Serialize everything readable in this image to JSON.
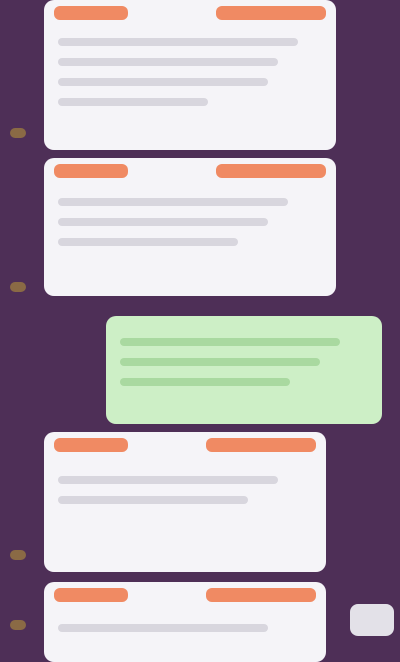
{
  "colors": {
    "background": "#4e2f57",
    "incoming_bubble": "#f5f4f8",
    "outgoing_bubble": "#cdefc6",
    "header_accent": "#f08a63"
  },
  "messages": [
    {
      "direction": "incoming",
      "sender": "",
      "tag": "",
      "text": "",
      "time": ""
    },
    {
      "direction": "incoming",
      "sender": "",
      "tag": "",
      "text": "",
      "time": ""
    },
    {
      "direction": "outgoing",
      "text": "",
      "time": ""
    },
    {
      "direction": "incoming",
      "sender": "",
      "tag": "",
      "text": "",
      "time": ""
    },
    {
      "direction": "incoming",
      "sender": "",
      "tag": "",
      "text": "",
      "time": ""
    }
  ],
  "icons": {
    "avatar": "avatar-icon",
    "scroll_chip": "chevron-down-icon"
  }
}
